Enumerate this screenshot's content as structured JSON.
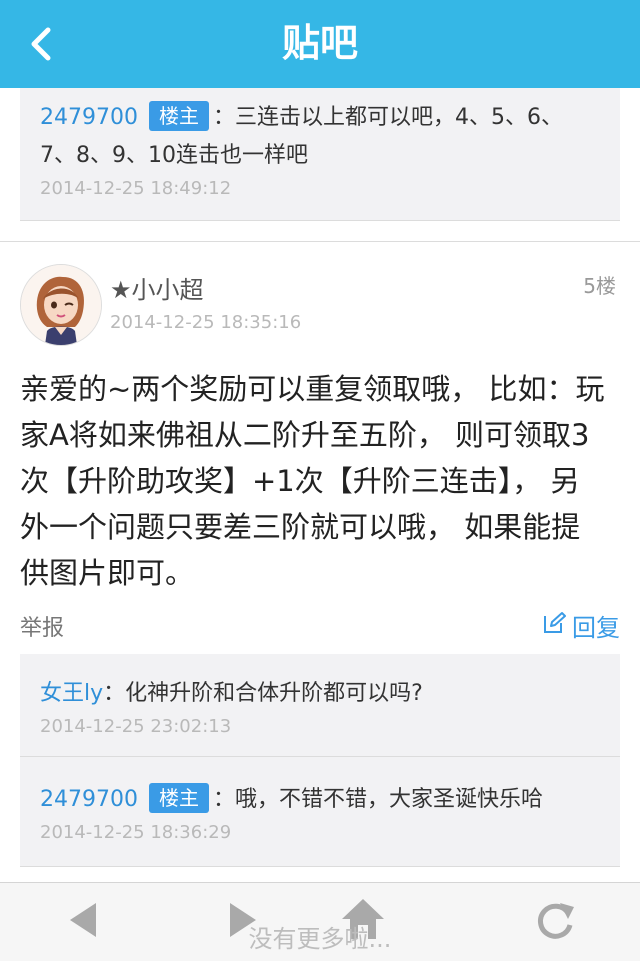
{
  "header": {
    "title": "贴吧"
  },
  "top_card": {
    "user": "2479700",
    "badge": "楼主",
    "text_line1": "：三连击以上都可以吧，4、5、6、",
    "text_line2": "7、8、9、10连击也一样吧",
    "time": "2014-12-25 18:49:12"
  },
  "post": {
    "author": "★小小超",
    "floor": "5楼",
    "time": "2014-12-25 18:35:16",
    "lines": [
      "亲爱的~两个奖励可以重复领取哦， 比如：玩",
      "家A将如来佛祖从二阶升至五阶， 则可领取3",
      "次【升阶助攻奖】+1次【升阶三连击】， 另",
      "外一个问题只要差三阶就可以哦， 如果能提",
      "供图片即可。"
    ],
    "report": "举报",
    "reply": "回复"
  },
  "replies": [
    {
      "user": "女王ly",
      "badge": "",
      "text": "：化神升阶和合体升阶都可以吗?",
      "time": "2014-12-25 23:02:13"
    },
    {
      "user": "2479700",
      "badge": "楼主",
      "text": "：哦，不错不错，大家圣诞快乐哈",
      "time": "2014-12-25 18:36:29"
    }
  ],
  "toolbar": {
    "no_more": "没有更多啦...",
    "icons": [
      "back-arrow-icon",
      "forward-arrow-icon",
      "home-icon",
      "refresh-icon"
    ]
  },
  "colors": {
    "header": "#35b7e6",
    "link": "#2f8fd8",
    "badge": "#3a9be6"
  }
}
